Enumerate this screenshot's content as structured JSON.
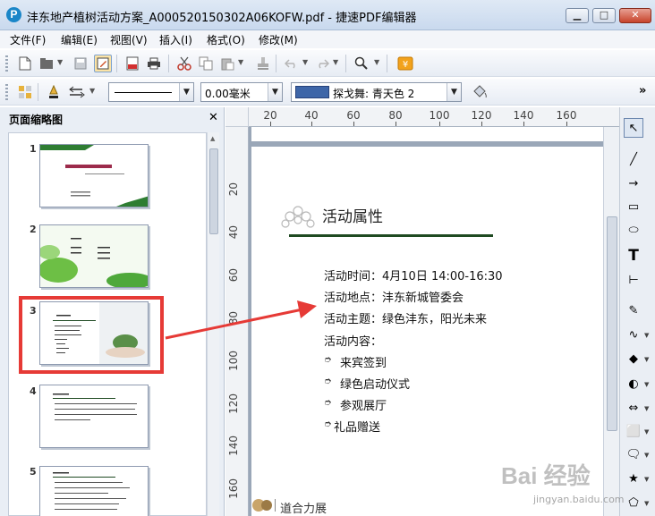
{
  "window": {
    "title": "沣东地产植树活动方案_A000520150302A06KOFW.pdf - 捷速PDF编辑器",
    "logo_letter": "P",
    "buttons": {
      "min": "▁",
      "max": "□",
      "close": "✕"
    }
  },
  "menu": [
    "文件(F)",
    "编辑(E)",
    "视图(V)",
    "插入(I)",
    "格式(O)",
    "修改(M)"
  ],
  "toolbar1": {
    "icons": [
      "new-document-icon",
      "open-folder-icon",
      "save-icon",
      "edit-icon",
      "pdf-icon",
      "print-icon",
      "cut-icon",
      "copy-icon",
      "paste-icon",
      "stamp-icon",
      "undo-icon",
      "redo-icon",
      "zoom-icon",
      "upgrade-icon"
    ]
  },
  "toolbar2": {
    "line_width": "0.00毫米",
    "fill_color_name": "探戈舞: 青天色 2",
    "fill_color": "#3e66a8",
    "overflow": "»"
  },
  "left_panel": {
    "title": "页面缩略图",
    "close": "✕",
    "pages": [
      "1",
      "2",
      "3",
      "4",
      "5"
    ],
    "highlighted_page": "3",
    "highlight_color": "#e63a36"
  },
  "rulers": {
    "h_labels": [
      "20",
      "40",
      "60",
      "80",
      "100",
      "120",
      "140",
      "160"
    ],
    "v_labels": [
      "20",
      "40",
      "60",
      "80",
      "100",
      "120",
      "140",
      "160"
    ]
  },
  "document": {
    "heading": "活动属性",
    "lines": [
      "活动时间：4月10日 14:00-16:30",
      "活动地点：沣东新城管委会",
      "活动主题：绿色沣东，阳光未来",
      "活动内容："
    ],
    "bullets": [
      "来宾签到",
      "绿色启动仪式",
      "参观展厅",
      "礼品赠送"
    ],
    "footer_text": "道合力展",
    "rule_color": "#1f4a22"
  },
  "right_tools": [
    "select-icon",
    "line-icon",
    "arrow-icon",
    "rectangle-icon",
    "ellipse-icon",
    "text-icon",
    "text-box-icon",
    "pencil-icon",
    "bezier-icon",
    "diamond-icon",
    "circle-icon",
    "double-arrow-icon",
    "shape-icon",
    "callout-icon",
    "star-icon",
    "polygon-icon"
  ],
  "right_tool_glyphs": [
    "↖",
    "╱",
    "→",
    "▭",
    "⬭",
    "T",
    "⊢",
    "✎",
    "∿",
    "◆",
    "◐",
    "⇔",
    "⬜",
    "🗨",
    "★",
    "⬠"
  ],
  "watermark": {
    "main": "Bai 经验",
    "sub": "jingyan.baidu.com"
  }
}
